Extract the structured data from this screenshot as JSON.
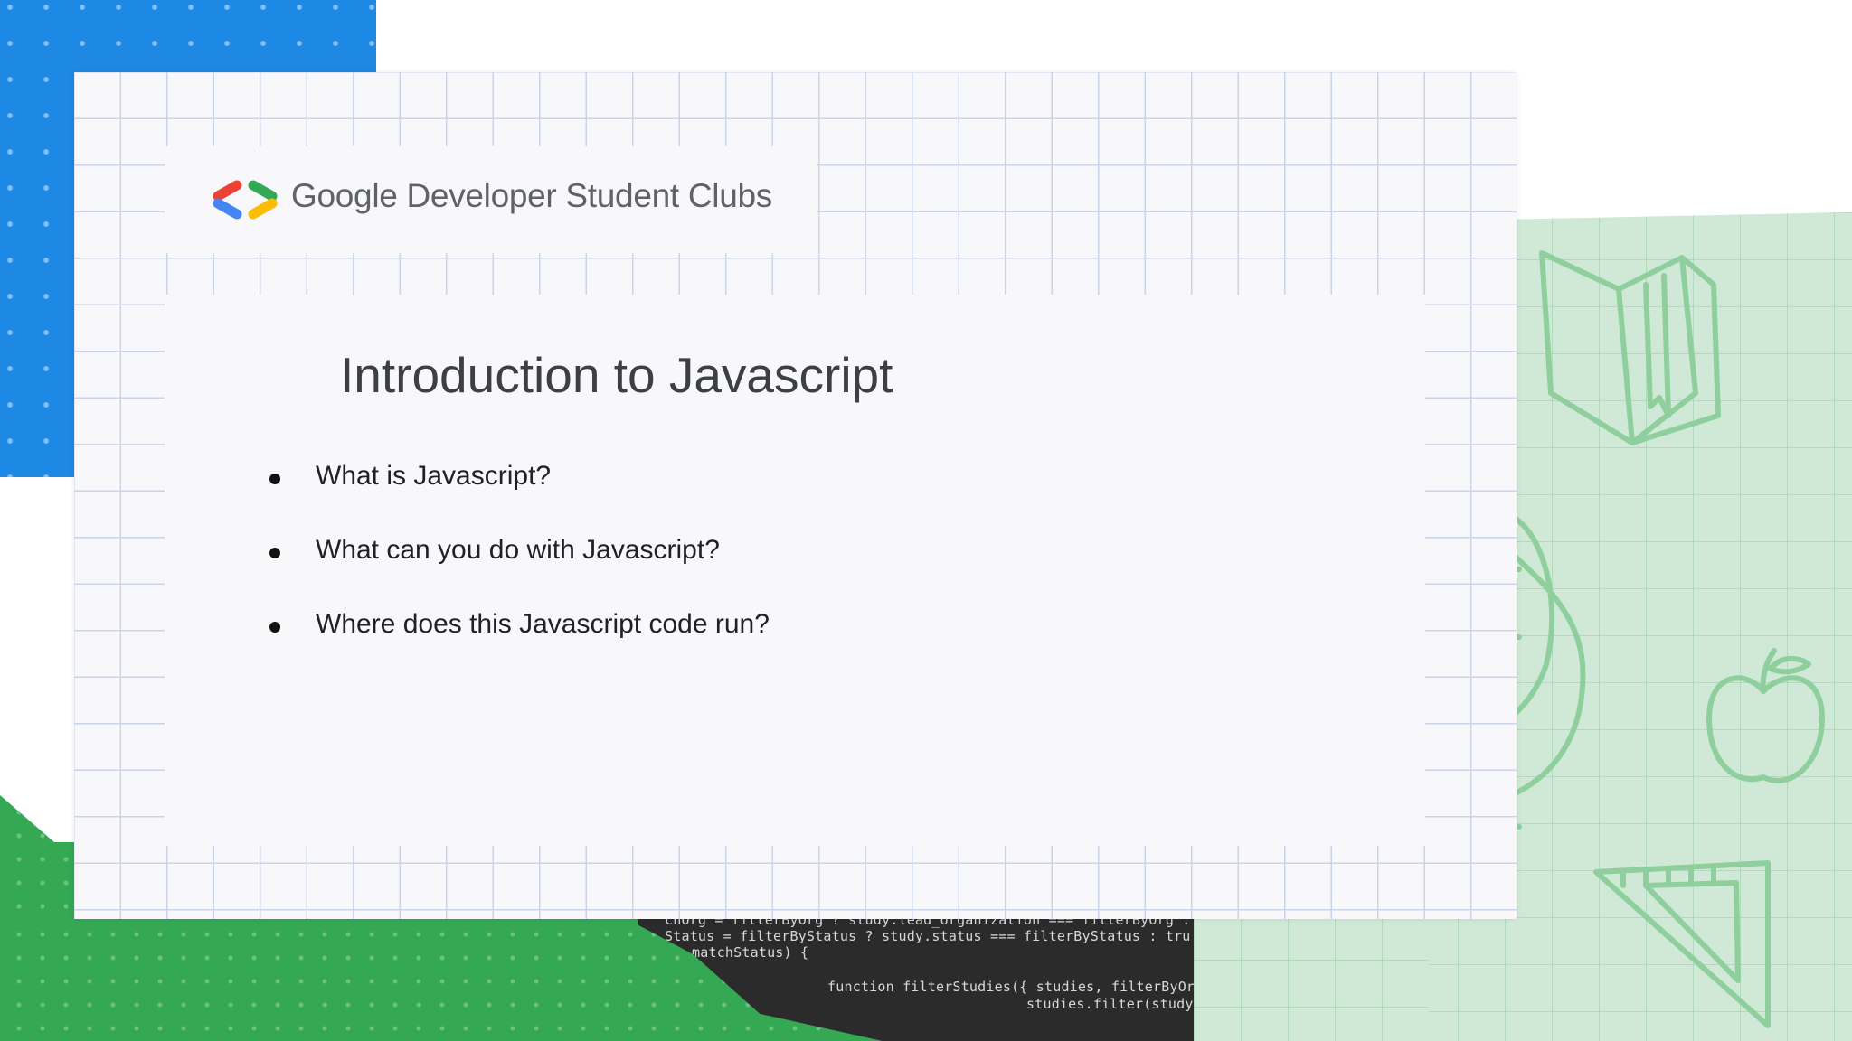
{
  "header": {
    "brand": "Google Developer Student Clubs",
    "logo_icon": "gdsc-brackets-logo-icon",
    "logo_colors": [
      "#ea4335",
      "#4285f4",
      "#34a853",
      "#fbbc04"
    ]
  },
  "slide": {
    "title": "Introduction to Javascript",
    "bullets": [
      "What is Javascript?",
      "What can you do with Javascript?",
      "Where does this Javascript code run?"
    ]
  },
  "background": {
    "code_lines": [
      "chOrg = filterByOrg ? study.lead_organization === filterByOrg : t",
      "Status = filterByStatus ? study.status === filterByStatus : tru",
      "matchStatus) {",
      "",
      "function filterStudies({ studies, filterByOrg",
      "studies.filter(study"
    ],
    "doodle_icons": [
      "book-icon",
      "globe-icon",
      "apple-icon",
      "ruler-triangle-icon"
    ],
    "colors": {
      "blue": "#1e88e5",
      "green": "#34a853",
      "light_green": "#cfe9d6"
    }
  }
}
